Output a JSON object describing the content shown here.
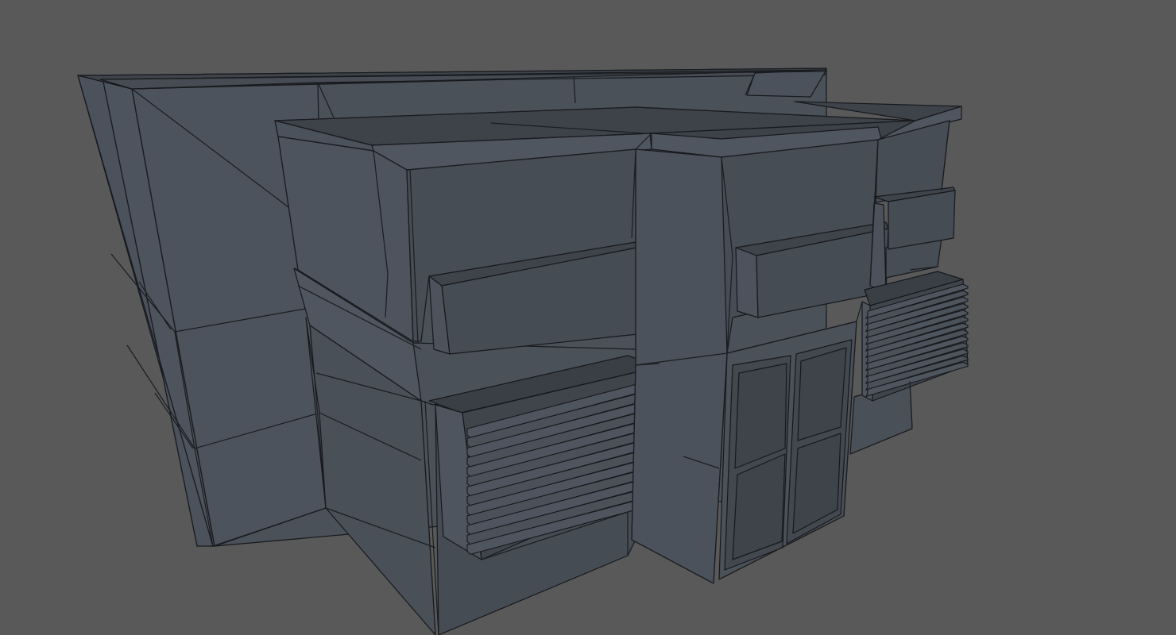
{
  "viewport": {
    "background_color": "#595959",
    "mesh_color": "#4b515a",
    "wire_color": "#1a1c20",
    "shade_colors": {
      "light": "#545a63",
      "mid": "#4a5058",
      "dark": "#3e434a",
      "top": "#3f444b"
    }
  },
  "scene": {
    "object": "building-model",
    "elements": [
      "back-block",
      "left-upper-block",
      "center-block",
      "right-block",
      "left-vent",
      "right-vent",
      "double-door",
      "awning-left",
      "awning-center",
      "awning-right"
    ]
  }
}
